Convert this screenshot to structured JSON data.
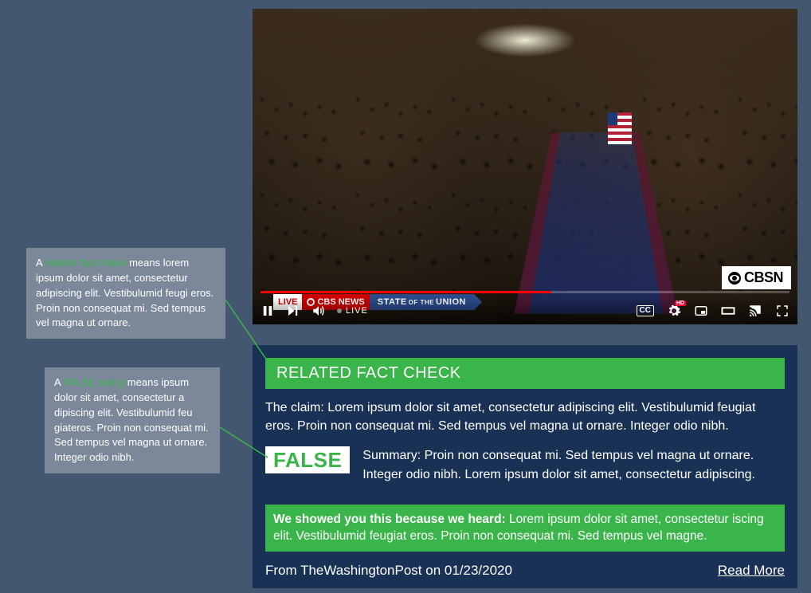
{
  "callouts": {
    "related": {
      "prefix": "A ",
      "highlight": "related fact check",
      "rest": " means lorem ipsum dolor sit amet, consectetur adipiscing elit. Vestibulumid feugi eros. Proin non consequat mi. Sed tempus vel magna ut ornare."
    },
    "false": {
      "prefix": "A ",
      "highlight": "FALSE rating",
      "rest": " means ipsum dolor sit amet, consectetur a dipiscing elit. Vestibulumid feu giateros. Proin non consequat mi. Sed tempus vel magna ut ornare. Integer odio nibh."
    }
  },
  "video": {
    "chyron": {
      "live": "LIVE",
      "network": "CBS NEWS",
      "headline_pre": "STATE",
      "headline_mid": "OF THE",
      "headline_post": "UNION"
    },
    "watermark": "CBSN",
    "controls": {
      "live_label": "LIVE",
      "cc_label": "CC",
      "hd_label": "HD"
    }
  },
  "card": {
    "header": "RELATED FACT CHECK",
    "claim": "The claim: Lorem ipsum dolor sit amet, consectetur adipiscing elit. Vestibulumid feugiat eros. Proin non consequat mi. Sed tempus vel magna ut ornare. Integer odio nibh.",
    "rating": "FALSE",
    "summary": "Summary: Proin non consequat mi. Sed tempus vel magna ut ornare. Integer odio nibh. Lorem ipsum dolor sit amet, consectetur adipiscing.",
    "reason_bold": "We showed you this because we heard:",
    "reason_rest": " Lorem ipsum dolor sit amet, consectetur iscing elit. Vestibulumid feugiat eros. Proin non consequat mi. Sed tempus vel magne.",
    "source": "From TheWashingtonPost on 01/23/2020",
    "readmore": "Read More"
  }
}
